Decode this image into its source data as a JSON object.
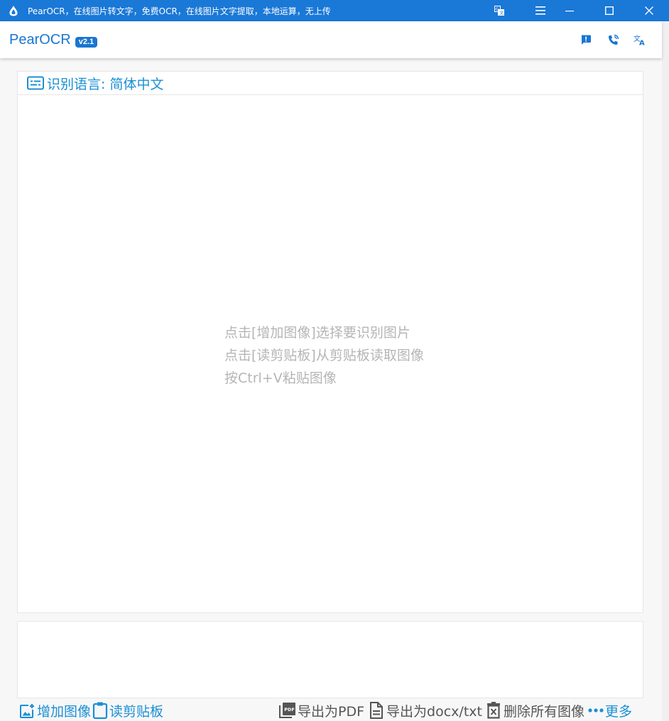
{
  "window": {
    "title": "PearOCR，在线图片转文字，免费OCR，在线图片文字提取，本地运算，无上传"
  },
  "header": {
    "brand": "PearOCR",
    "version": "v2.1",
    "actions": [
      "feedback-icon",
      "contact-phone-icon",
      "translate-icon"
    ]
  },
  "language_bar": {
    "label": "识别语言: 简体中文"
  },
  "hints": [
    "点击[增加图像]选择要识别图片",
    "点击[读剪贴板]从剪贴板读取图像",
    "按Ctrl+V粘贴图像"
  ],
  "toolbar": {
    "add_image": "增加图像",
    "read_clipboard": "读剪贴板",
    "export_pdf": "导出为PDF",
    "export_docx": "导出为docx/txt",
    "delete_all": "删除所有图像",
    "more": "更多"
  },
  "colors": {
    "titlebar": "#1a78d7",
    "brand": "#1976d2",
    "accent": "#1a8fd6",
    "hint_text": "#b5b5b5"
  }
}
